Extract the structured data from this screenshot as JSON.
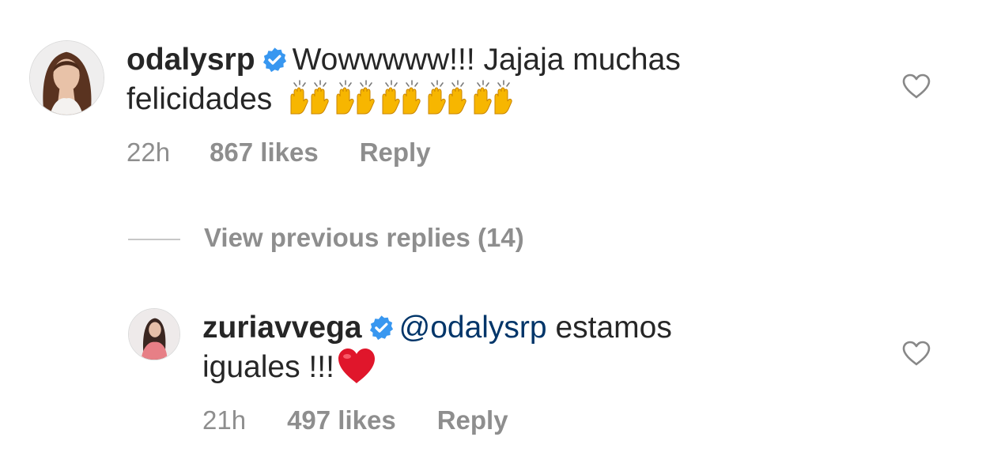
{
  "comments": [
    {
      "username": "odalysrp",
      "verified": true,
      "text_line1": "Wowwwww!!! Jajaja muchas",
      "text_line2": "felicidades",
      "emoji": "raising-hands",
      "emoji_count": 5,
      "time": "22h",
      "likes": "867 likes",
      "reply": "Reply"
    },
    {
      "username": "zuriavvega",
      "verified": true,
      "mention": "@odalysrp",
      "text_line1_rest": "estamos",
      "text_line2": "iguales !!!",
      "emoji": "red-heart",
      "time": "21h",
      "likes": "497 likes",
      "reply": "Reply"
    }
  ],
  "view_replies": "View previous replies (14)",
  "colors": {
    "text": "#262626",
    "meta": "#8e8e8e",
    "verified": "#3897f0",
    "mention": "#003569",
    "heart": "#e0162b"
  },
  "icons": {
    "verified": "verified-badge-icon",
    "like": "heart-outline-icon"
  }
}
